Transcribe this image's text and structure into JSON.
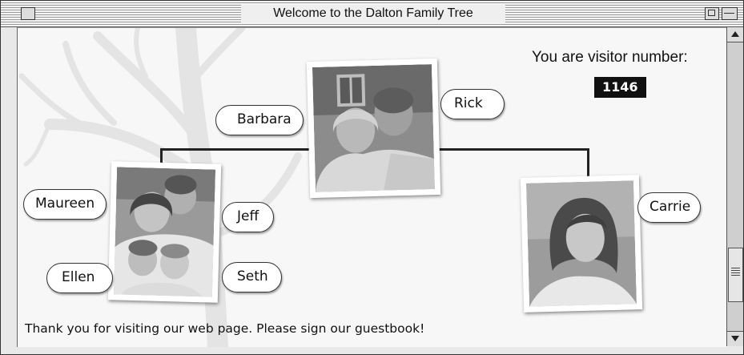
{
  "window": {
    "title": "Welcome to the Dalton Family Tree"
  },
  "visitor": {
    "label": "You are visitor number:",
    "count": "1146"
  },
  "people": {
    "barbara": "Barbara",
    "rick": "Rick",
    "maureen": "Maureen",
    "jeff": "Jeff",
    "ellen": "Ellen",
    "seth": "Seth",
    "carrie": "Carrie"
  },
  "footer": {
    "message": "Thank you for visiting our web page. Please sign our guestbook!"
  },
  "colors": {
    "window_bg": "#e9e9e9",
    "content_bg": "#f7f7f7",
    "counter_bg": "#111111",
    "counter_text": "#ffffff"
  },
  "icons": [
    "close-box-icon",
    "zoom-box-icon",
    "collapse-box-icon",
    "scroll-up-arrow-icon",
    "scroll-down-arrow-icon"
  ]
}
